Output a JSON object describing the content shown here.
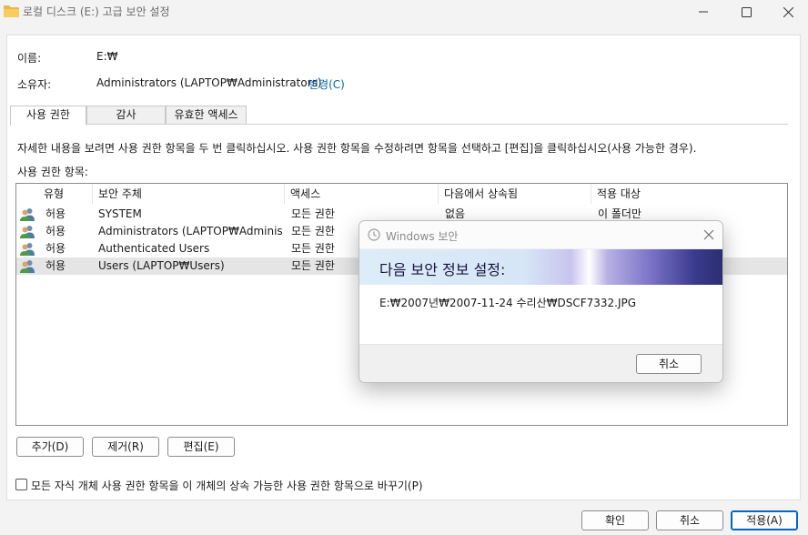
{
  "window": {
    "title": "로컬 디스크 (E:) 고급 보안 설정",
    "icon": "folder-icon"
  },
  "info": {
    "name_label": "이름:",
    "name_value": "E:₩",
    "owner_label": "소유자:",
    "owner_value": "Administrators (LAPTOP₩Administrators)",
    "change_link": "변경(C)"
  },
  "tabs": [
    {
      "label": "사용 권한",
      "active": true
    },
    {
      "label": "감사",
      "active": false
    },
    {
      "label": "유효한 액세스",
      "active": false
    }
  ],
  "instructions": "자세한 내용을 보려면 사용 권한 항목을 두 번 클릭하십시오. 사용 권한 항목을 수정하려면 항목을 선택하고 [편집]을 클릭하십시오(사용 가능한 경우).",
  "list_label": "사용 권한 항목:",
  "columns": [
    "유형",
    "보안 주체",
    "액세스",
    "다음에서 상속됨",
    "적용 대상"
  ],
  "rows": [
    {
      "type": "허용",
      "principal": "SYSTEM",
      "access": "모든 권한",
      "inherited": "없음",
      "applies": "이 폴더만",
      "selected": false
    },
    {
      "type": "허용",
      "principal": "Administrators (LAPTOP₩Administr...",
      "access": "모든 권한",
      "inherited": "",
      "applies": "",
      "selected": false
    },
    {
      "type": "허용",
      "principal": "Authenticated Users",
      "access": "모든 권한",
      "inherited": "",
      "applies": "",
      "selected": false
    },
    {
      "type": "허용",
      "principal": "Users (LAPTOP₩Users)",
      "access": "모든 권한",
      "inherited": "",
      "applies": "",
      "selected": true
    }
  ],
  "buttons": {
    "add": "추가(D)",
    "remove": "제거(R)",
    "edit": "편집(E)"
  },
  "replace_checkbox": {
    "label": "모든 자식 개체 사용 권한 항목을 이 개체의 상속 가능한 사용 권한 항목으로 바꾸기(P)",
    "checked": false
  },
  "footer": {
    "ok": "확인",
    "cancel": "취소",
    "apply": "적용(A)"
  },
  "progress_dialog": {
    "title": "Windows 보안",
    "heading": "다음 보안 정보 설정:",
    "path": "E:₩2007년₩2007-11-24 수리산₩DSCF7332.JPG",
    "cancel": "취소"
  },
  "colors": {
    "link": "#0066b4",
    "selected_row": "#e5e5e5",
    "primary_border": "#0067c0"
  }
}
